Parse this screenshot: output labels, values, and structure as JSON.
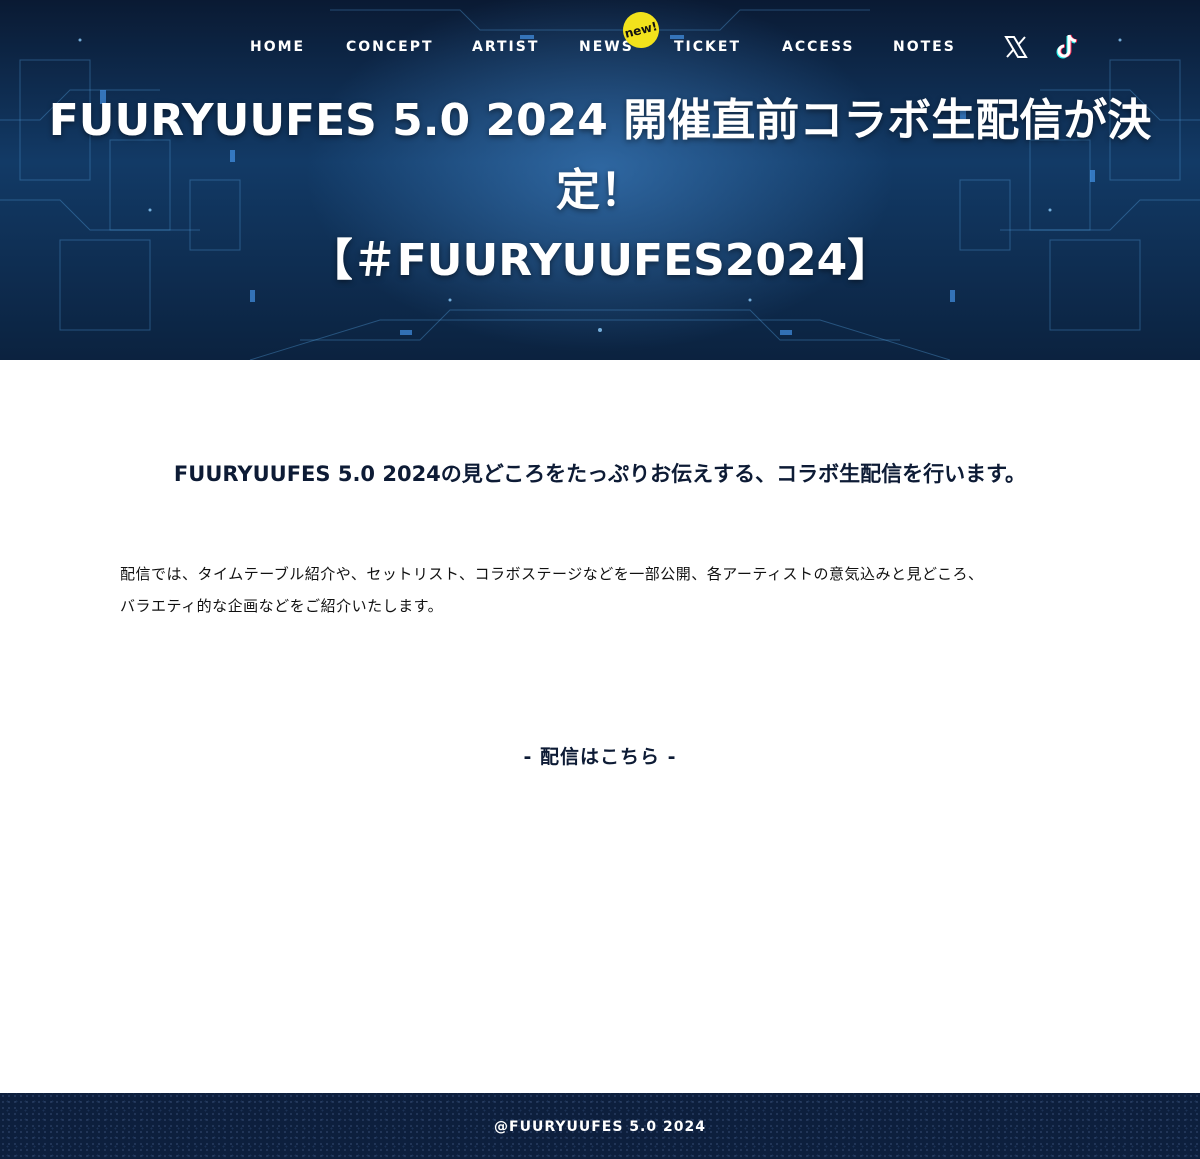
{
  "nav": {
    "items": [
      {
        "label": "HOME"
      },
      {
        "label": "CONCEPT"
      },
      {
        "label": "ARTIST"
      },
      {
        "label": "NEWS"
      },
      {
        "label": "TICKET"
      },
      {
        "label": "ACCESS"
      },
      {
        "label": "NOTES"
      }
    ],
    "badge": "new!",
    "social": [
      "x-icon",
      "tiktok-icon"
    ]
  },
  "hero": {
    "title_line1": "FUURYUUFES 5.0 2024 開催直前コラボ生配信が決",
    "title_line2": "定！",
    "title_line3": "【＃FUURYUUFES2024】"
  },
  "content": {
    "lead": "FUURYUUFES 5.0 2024の見どころをたっぷりお伝えする、コラボ生配信を行います。",
    "body_line1": "配信では、タイムテーブル紹介や、セットリスト、コラボステージなどを一部公開、各アーティストの意気込みと見どころ、",
    "body_line2": "バラエティ的な企画などをご紹介いたします。",
    "stream_link": "- 配信はこちら -"
  },
  "footer": {
    "copyright": "@FUURYUUFES 5.0 2024"
  },
  "colors": {
    "hero_dark": "#0a1a33",
    "hero_glow": "#468cd2",
    "text_navy": "#0d1b35",
    "badge_yellow": "#f2e21c",
    "footer_bg": "#0d1f3d"
  }
}
